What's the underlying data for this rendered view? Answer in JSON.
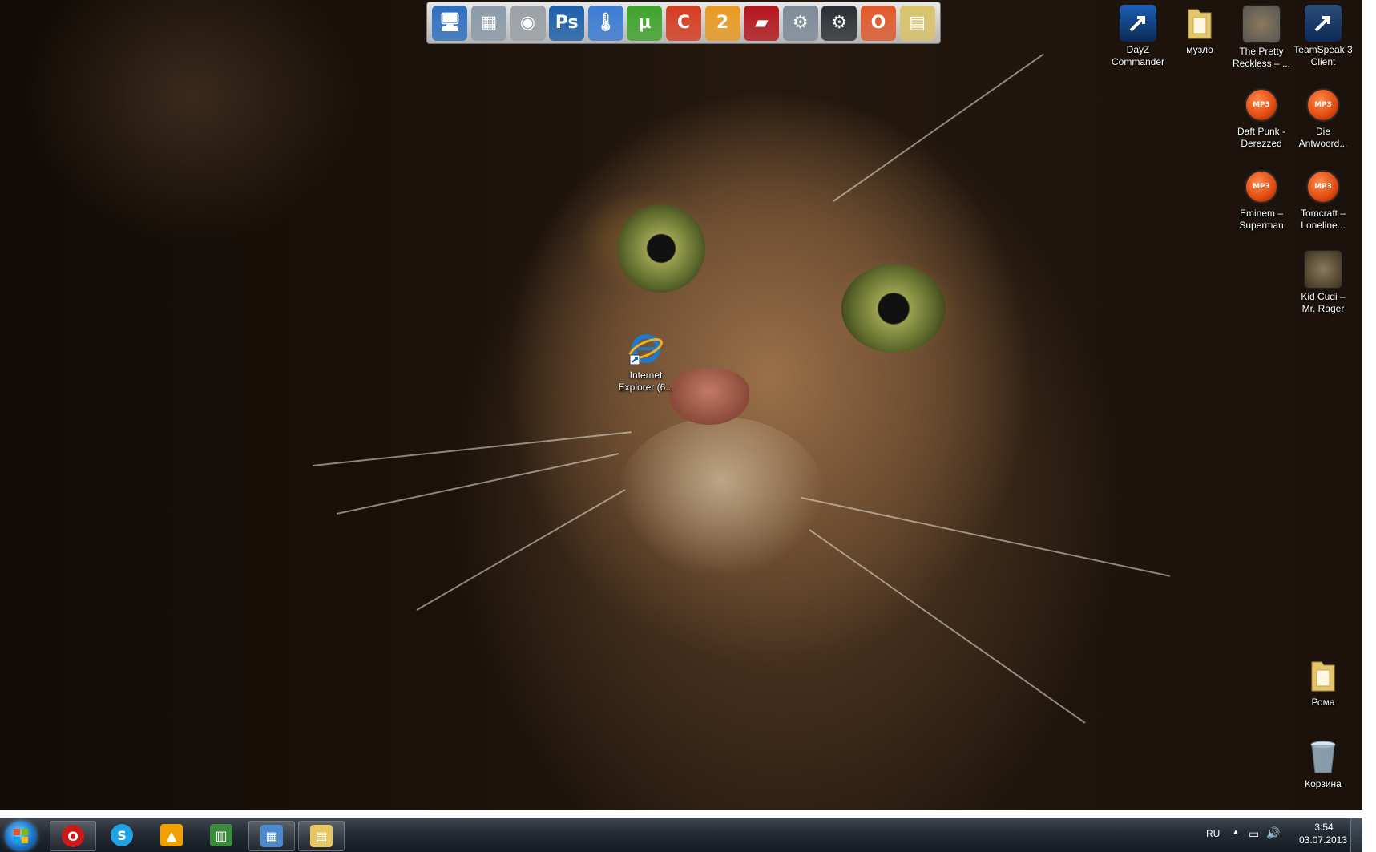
{
  "dock": {
    "items": [
      {
        "name": "computer-icon",
        "glyph": "🖥",
        "color": "#2e6fc0"
      },
      {
        "name": "pictures-icon",
        "glyph": "▦",
        "color": "#8a9aa8"
      },
      {
        "name": "speaker-icon",
        "glyph": "◉",
        "color": "#9aa0a6"
      },
      {
        "name": "photoshop-icon",
        "glyph": "Ps",
        "color": "#1b5fa8"
      },
      {
        "name": "thermometer-icon",
        "glyph": "🌡",
        "color": "#3a7bd5"
      },
      {
        "name": "utorrent-icon",
        "glyph": "µ",
        "color": "#3ea32b"
      },
      {
        "name": "ccleaner-icon",
        "glyph": "C",
        "color": "#d63b1f"
      },
      {
        "name": "map-pin-icon",
        "glyph": "2",
        "color": "#e89a1f"
      },
      {
        "name": "stripes-icon",
        "glyph": "▰",
        "color": "#b4141c"
      },
      {
        "name": "robot-icon",
        "glyph": "⚙",
        "color": "#7d8a98"
      },
      {
        "name": "steam-icon",
        "glyph": "⚙",
        "color": "#2a2d33"
      },
      {
        "name": "opera-dock-icon",
        "glyph": "O",
        "color": "#e0582a"
      },
      {
        "name": "folder-dock-icon",
        "glyph": "▤",
        "color": "#d9c36a"
      }
    ]
  },
  "desktop_icons": [
    {
      "name": "dayz-commander-shortcut",
      "label": "DayZ\nCommander",
      "type": "app",
      "color": "#1c5fb4"
    },
    {
      "name": "muzlo-folder",
      "label": "музло",
      "type": "folder",
      "color": "#e3c56e"
    },
    {
      "name": "pretty-reckless-file",
      "label": "The Pretty\nReckless – ...",
      "type": "image",
      "color": "#555"
    },
    {
      "name": "teamspeak-shortcut",
      "label": "TeamSpeak 3\nClient",
      "type": "app",
      "color": "#2b4d7a"
    },
    {
      "name": "daft-punk-mp3",
      "label": "Daft Punk -\nDerezzed",
      "type": "mp3",
      "color": ""
    },
    {
      "name": "die-antwoord-mp3",
      "label": "Die\nAntwoord...",
      "type": "mp3",
      "color": ""
    },
    {
      "name": "eminem-mp3",
      "label": "Eminem –\nSuperman",
      "type": "mp3",
      "color": ""
    },
    {
      "name": "tomcraft-mp3",
      "label": "Tomcraft –\nLoneline...",
      "type": "mp3",
      "color": ""
    },
    {
      "name": "kid-cudi-file",
      "label": "Kid Cudi –\nMr. Rager",
      "type": "image",
      "color": "#3a3020"
    },
    {
      "name": "internet-explorer-shortcut",
      "label": "Internet\nExplorer (6...",
      "type": "ie",
      "color": "#1e7ad0"
    },
    {
      "name": "roma-folder",
      "label": "Рома",
      "type": "folder",
      "color": "#e3c56e"
    },
    {
      "name": "recycle-bin",
      "label": "Корзина",
      "type": "bin",
      "color": "#9bb4c6"
    }
  ],
  "mp3_badge": "MP3",
  "taskbar": {
    "language": "RU",
    "time": "3:54",
    "date": "03.07.2013",
    "pinned": [
      {
        "name": "opera-taskbar-button",
        "color": "#cc1a1a",
        "glyph": "O"
      },
      {
        "name": "skype-taskbar-button",
        "color": "#1fa3e6",
        "glyph": "S"
      },
      {
        "name": "aimp-taskbar-button",
        "color": "#f0a000",
        "glyph": "▲"
      },
      {
        "name": "task-manager-taskbar-button",
        "color": "#3e8a3e",
        "glyph": "▥"
      },
      {
        "name": "control-panel-taskbar-button",
        "color": "#4a8ad0",
        "glyph": "▦"
      },
      {
        "name": "explorer-taskbar-button",
        "color": "#e8c660",
        "glyph": "▤"
      }
    ]
  }
}
